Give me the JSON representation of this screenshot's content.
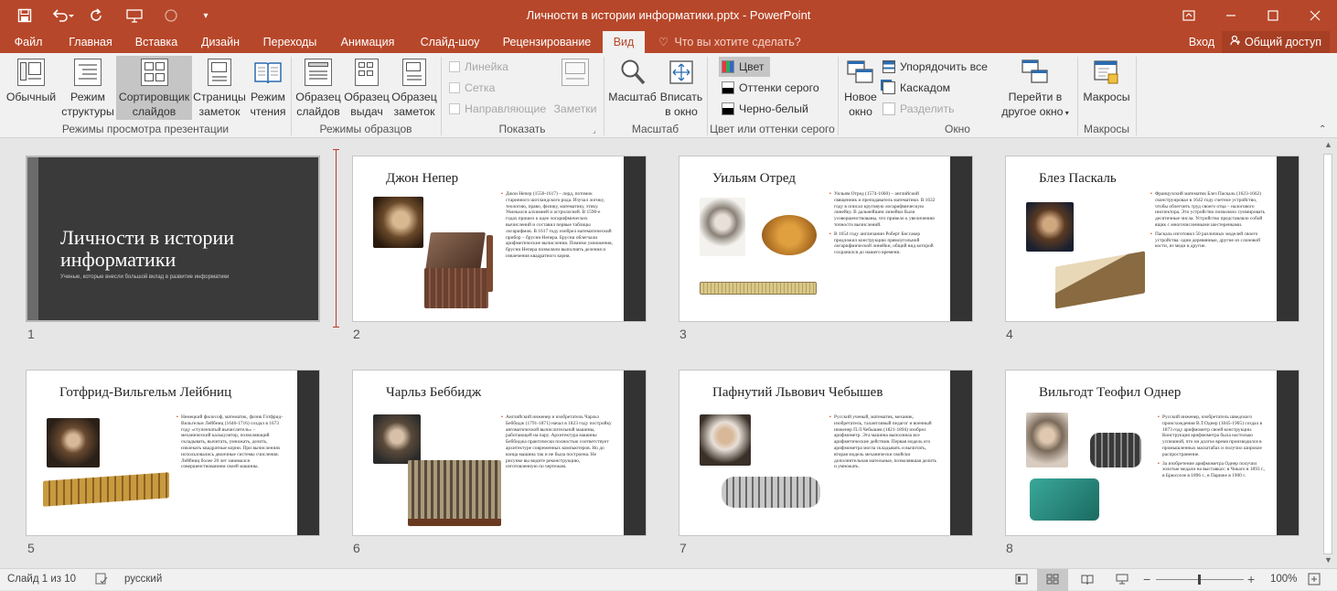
{
  "window": {
    "title": "Личности в истории информатики.pptx - PowerPoint"
  },
  "qat": {
    "save": "save-icon",
    "undo": "undo-icon",
    "redo": "repeat-icon",
    "customize": "customize-icon"
  },
  "tabs": [
    {
      "label": "Файл"
    },
    {
      "label": "Главная"
    },
    {
      "label": "Вставка"
    },
    {
      "label": "Дизайн"
    },
    {
      "label": "Переходы"
    },
    {
      "label": "Анимация"
    },
    {
      "label": "Слайд-шоу"
    },
    {
      "label": "Рецензирование"
    },
    {
      "label": "Вид"
    }
  ],
  "tellme": {
    "placeholder": "Что вы хотите сделать?"
  },
  "account": {
    "signin": "Вход",
    "share": "Общий доступ"
  },
  "ribbon": {
    "views": {
      "normal": "Обычный",
      "outline_1": "Режим",
      "outline_2": "структуры",
      "sorter_1": "Сортировщик",
      "sorter_2": "слайдов",
      "notes_1": "Страницы",
      "notes_2": "заметок",
      "reading_1": "Режим",
      "reading_2": "чтения",
      "group": "Режимы просмотра презентации"
    },
    "masters": {
      "slide_1": "Образец",
      "slide_2": "слайдов",
      "handout_1": "Образец",
      "handout_2": "выдач",
      "notes_1": "Образец",
      "notes_2": "заметок",
      "group": "Режимы образцов"
    },
    "show": {
      "ruler": "Линейка",
      "grid": "Сетка",
      "guides": "Направляющие",
      "notes": "Заметки",
      "group": "Показать"
    },
    "zoom": {
      "zoom": "Масштаб",
      "fit_1": "Вписать",
      "fit_2": "в окно",
      "group": "Масштаб"
    },
    "color": {
      "color": "Цвет",
      "gray": "Оттенки серого",
      "bw": "Черно-белый",
      "group": "Цвет или оттенки серого"
    },
    "window": {
      "new_1": "Новое",
      "new_2": "окно",
      "arrange": "Упорядочить все",
      "cascade": "Каскадом",
      "split": "Разделить",
      "switch_1": "Перейти в",
      "switch_2": "другое окно",
      "group": "Окно"
    },
    "macros": {
      "macros": "Макросы",
      "group": "Макросы"
    }
  },
  "slides": [
    {
      "num": "1",
      "title": "Личности в истории информатики",
      "subtitle": "Ученые, которые внесли большой вклад в развитие информатики"
    },
    {
      "num": "2",
      "title": "Джон Непер",
      "text": [
        "Джон Непер (1550-1617) – лорд, потомок старинного шотландского рода. Изучал логику, теологию, право, физику, математику, этику. Увлекался алхимией и астрологией. В 1590-е годах пришел к идее логарифмических вычислений и составил первые таблицы логарифмов. В 1617 году изобрел математический прибор – брусни Непера. Брусни облегчали арифметические вычисления. Помимо умножения, брусни Непера позволяли выполнять деления и извлечения квадратного корня."
      ]
    },
    {
      "num": "3",
      "title": "Уильям Отред",
      "text": [
        "Уильям Отред (1574-1660) – английский священник и преподаватель математики. В 1632 году в описал круговую логарифмическую линейку. В дальнейшем линейки были усовершенствованы, что привело к увеличению точности вычислений.",
        "В 1654 году англичанин Роберт Биссакер предложил конструкцию прямоугольной логарифмической линейки, общий вид которой сохранился до нашего времени."
      ]
    },
    {
      "num": "4",
      "title": "Блез Паскаль",
      "text": [
        "Французский математик Блез Паскаль (1623-1662) сконструировал в 1642 году счетное устройство, чтобы облегчить труд своего отца – налогового инспектора. Это устройство позволяло суммировать десятичные числа. Устройство представляло собой ящик с многочисленными шестеренками.",
        "Паскаль изготовил 50 различных моделей своего устройства: одни деревянные, другие из слоновой кости, из меди и другие."
      ]
    },
    {
      "num": "5",
      "title": "Готфрид-Вильгельм Лейбниц",
      "text": [
        "Немецкий философ, математик, физик Готфрид-Вильгельм Лейбниц (1646-1716) создал в 1673 году «ступенчатый вычислитель» – механический калькулятор, позволяющий складывать, вычитать, умножать, делить, извлекать квадратные корни. При вычислениях использовались двоичные системы счисления. Лейбниц более 20 лет занимался совершенствованием своей машины."
      ]
    },
    {
      "num": "6",
      "title": "Чарльз Беббидж",
      "text": [
        "Английский инженер и изобретатель Чарльз Беббидж (1791-1871) начал в 1823 году постройку автоматической вычислительной машины, работающей на пару. Архитектура машины Беббиджа практически полностью соответствует архитектуре современных компьютеров. Но до конца машина так и не была построена. Не рисунке вы видите реконструкцию, изготовленную по чертежам."
      ]
    },
    {
      "num": "7",
      "title": "Пафнутий Львович Чебышев",
      "text": [
        "Русский ученый, математик, механик, изобретатель, талантливый педагог и военный инженер П.Л.Чебышев (1821-1894) изобрел арифмометр. Эта машина выполняла все арифметические действия. Первая модель его арифмометра могла складывать и вычитать, вторая модель механически свойски дополнительная мательные, позволявшая делить и умножать."
      ]
    },
    {
      "num": "8",
      "title": "Вильгодт Теофил Однер",
      "text": [
        "Русский инженер, изобретатель шведского происхождения В.Т.Однер (1845-1905) создал в 1873 году арифмометр своей конструкции. Конструкция арифмометра была настолько успешной, что он долгое время производился в промышленных масштабах и получил широкое распространение.",
        "За изобретение арифмометра Однер получил золотые медали на выставках: в Чикаго в 1893 г., в Брюсселе в 1896 г., в Париже в 1900 г."
      ]
    }
  ],
  "status": {
    "slide": "Слайд 1 из 10",
    "language": "русский",
    "zoom": "100%"
  },
  "colors": {
    "accent": "#b7472a",
    "ribbon": "#f1f1f1",
    "stage": "#e6e6e6"
  }
}
